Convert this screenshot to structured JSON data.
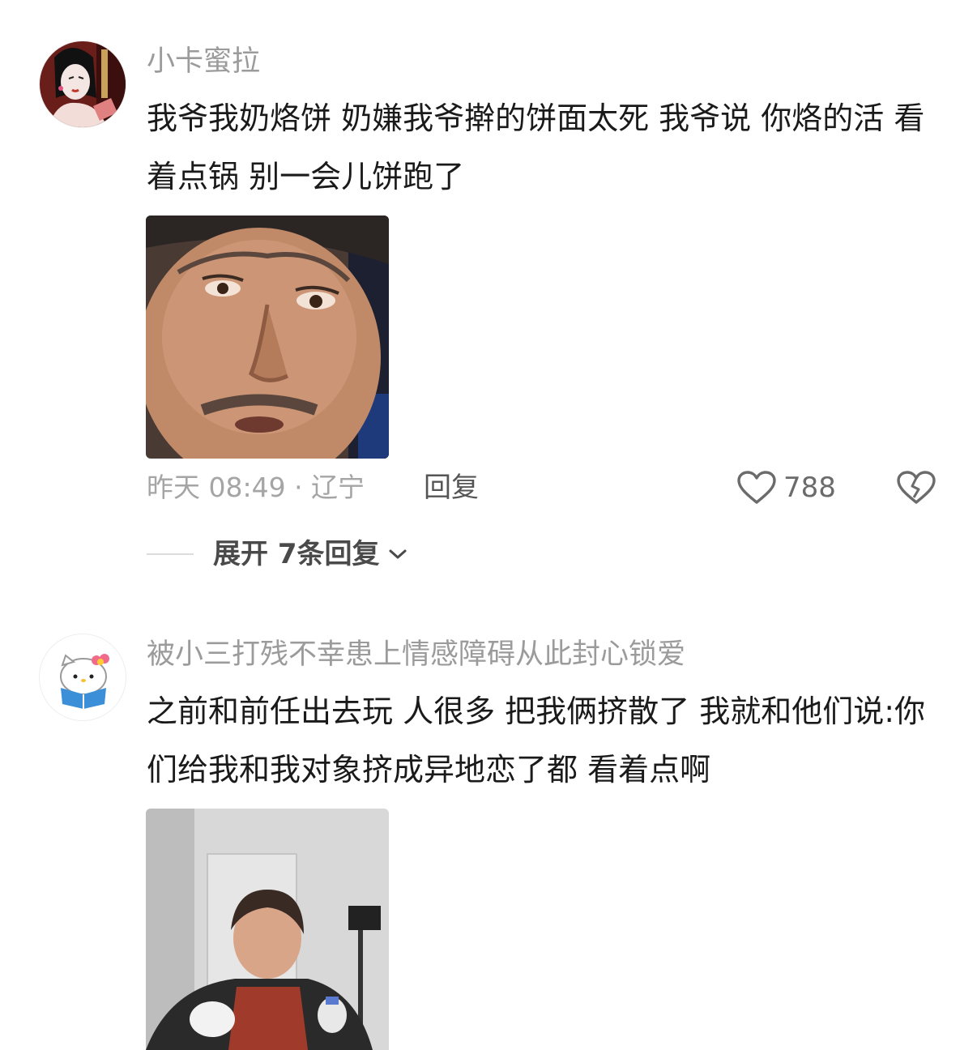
{
  "comments": [
    {
      "username": "小卡蜜拉",
      "text": "我爷我奶烙饼 奶嫌我爷擀的饼面太死 我爷说 你烙的活 看着点锅 别一会儿饼跑了",
      "time_location": "昨天 08:49 · 辽宁",
      "reply_label": "回复",
      "like_count": "788",
      "expand_label": "展开 7条回复"
    },
    {
      "username": "被小三打残不幸患上情感障碍从此封心锁爱",
      "text": "之前和前任出去玩 人很多 把我俩挤散了 我就和他们说:你们给我和我对象挤成异地恋了都 看着点啊"
    }
  ],
  "icons": {
    "like": "heart-outline-icon",
    "dislike": "broken-heart-icon",
    "expand": "chevron-down-icon"
  },
  "colors": {
    "username": "#9b9b9b",
    "text": "#1a1a1a",
    "meta": "#a5a5a5"
  }
}
